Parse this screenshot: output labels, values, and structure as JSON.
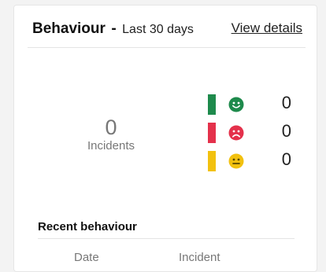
{
  "header": {
    "title": "Behaviour",
    "separator": "-",
    "period": "Last 30 days",
    "view_details": "View details"
  },
  "summary": {
    "total_count": "0",
    "total_label": "Incidents"
  },
  "categories": [
    {
      "name": "positive",
      "color": "#1e8a4c",
      "icon": "smiley-face-icon",
      "count": "0"
    },
    {
      "name": "negative",
      "color": "#e4314b",
      "icon": "sad-face-icon",
      "count": "0"
    },
    {
      "name": "neutral",
      "color": "#f2c10f",
      "icon": "neutral-face-icon",
      "count": "0"
    }
  ],
  "recent": {
    "title": "Recent behaviour",
    "columns": [
      "Date",
      "Incident"
    ]
  }
}
